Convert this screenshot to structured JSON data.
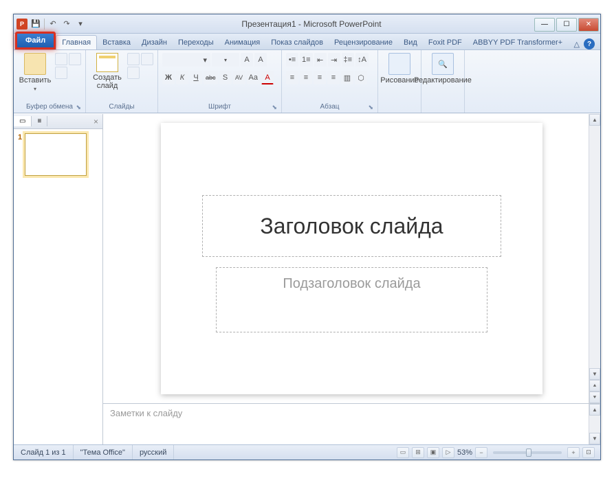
{
  "title": "Презентация1 - Microsoft PowerPoint",
  "qat": {
    "save": "💾",
    "undo": "↶",
    "redo": "↷"
  },
  "tabs": {
    "file": "Файл",
    "items": [
      "Главная",
      "Вставка",
      "Дизайн",
      "Переходы",
      "Анимация",
      "Показ слайдов",
      "Рецензирование",
      "Вид",
      "Foxit PDF",
      "ABBYY PDF Transformer+"
    ],
    "active": 0,
    "minimize": "△"
  },
  "ribbon": {
    "clipboard": {
      "label": "Буфер обмена",
      "paste": "Вставить"
    },
    "slides": {
      "label": "Слайды",
      "new": "Создать\nслайд"
    },
    "font": {
      "label": "Шрифт",
      "bold": "Ж",
      "italic": "К",
      "underline": "Ч",
      "strike": "abc",
      "shadow": "S",
      "spacing": "AV",
      "case": "Aa",
      "clear": "A",
      "grow": "A",
      "shrink": "A",
      "color": "A"
    },
    "paragraph": {
      "label": "Абзац"
    },
    "drawing": {
      "label": "Рисование"
    },
    "editing": {
      "label": "Редактирование"
    }
  },
  "panel": {
    "tab_slides_icon": "▭",
    "tab_outline_icon": "≡",
    "close": "×",
    "thumb1_num": "1"
  },
  "slide": {
    "title_placeholder": "Заголовок слайда",
    "subtitle_placeholder": "Подзаголовок слайда"
  },
  "notes": {
    "placeholder": "Заметки к слайду"
  },
  "status": {
    "slide_info": "Слайд 1 из 1",
    "theme": "\"Тема Office\"",
    "language": "русский",
    "zoom": "53%",
    "minus": "−",
    "plus": "+",
    "fit": "⊡"
  }
}
